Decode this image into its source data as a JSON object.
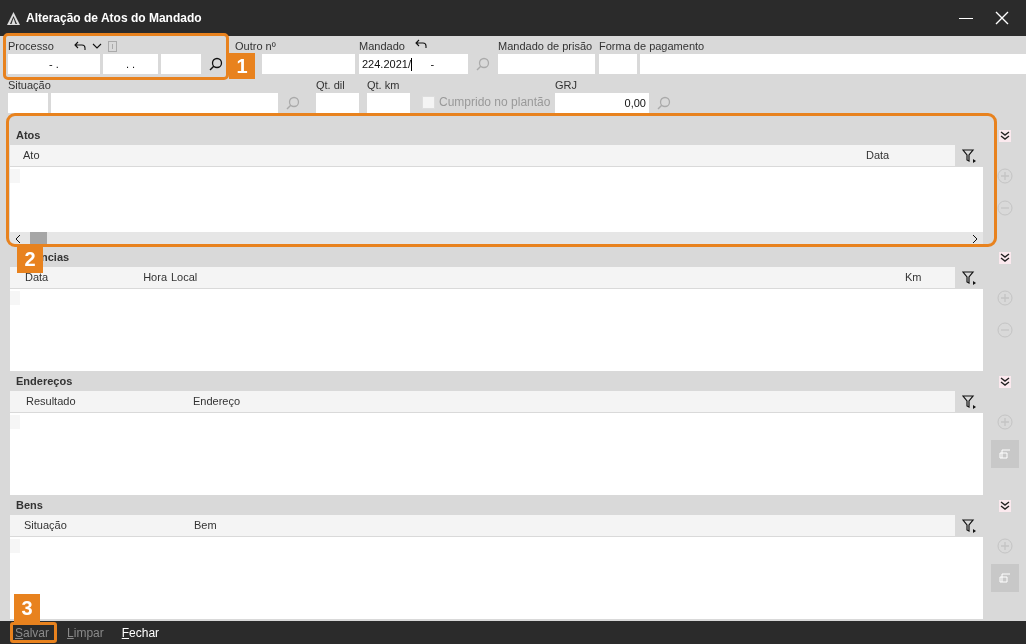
{
  "window": {
    "title": "Alteração de Atos do Mandado"
  },
  "fields_row_1": [
    {
      "label": "Processo",
      "history_icons": true,
      "inputs": [
        {
          "kind": "text",
          "value": "- ."
        },
        {
          "kind": "text",
          "value": ". ."
        },
        {
          "kind": "text"
        }
      ],
      "search": {
        "disabled": false
      }
    },
    {
      "label": "Outro nº",
      "inputs": [
        {
          "kind": "text"
        }
      ]
    },
    {
      "label": "Mandado",
      "undo_icon": true,
      "inputs": [
        {
          "kind": "text",
          "value": "224.2021/",
          "suffix": "-"
        }
      ],
      "search": {
        "disabled": true
      }
    },
    {
      "label": "Mandado de prisão",
      "inputs": [
        {
          "kind": "text"
        }
      ]
    },
    {
      "label": "Forma de pagamento",
      "inputs": [
        {
          "kind": "text"
        },
        {
          "kind": "text"
        }
      ]
    }
  ],
  "fields_row_2": [
    {
      "label": "Situação",
      "inputs": [
        {
          "kind": "text"
        },
        {
          "kind": "text"
        }
      ],
      "search": {
        "disabled": true
      }
    },
    {
      "label": "Qt. dil",
      "inputs": [
        {
          "kind": "text"
        }
      ]
    },
    {
      "label": "Qt. km",
      "inputs": [
        {
          "kind": "text"
        }
      ]
    },
    {
      "kind": "checkbox",
      "label": "Cumprido no plantão",
      "checked": false,
      "disabled": true
    },
    {
      "label": "GRJ",
      "inputs": [
        {
          "kind": "text",
          "value": "0,00"
        }
      ],
      "search": {
        "disabled": true
      }
    }
  ],
  "sections": [
    {
      "title": "Atos",
      "columns": [
        "Ato",
        "Data"
      ],
      "horizontal_scrollbar": true,
      "actions": [
        {
          "kind": "add",
          "disabled": true
        },
        {
          "kind": "remove",
          "disabled": true
        }
      ]
    },
    {
      "title": "ncias",
      "columns": [
        "Data",
        "Hora",
        "Local",
        "Km"
      ],
      "actions": [
        {
          "kind": "add",
          "disabled": true
        },
        {
          "kind": "remove",
          "disabled": true
        }
      ]
    },
    {
      "title": "Endereços",
      "columns": [
        "Resultado",
        "Endereço"
      ],
      "actions": [
        {
          "kind": "add",
          "disabled": true
        },
        {
          "kind": "detach",
          "disabled": true
        }
      ]
    },
    {
      "title": "Bens",
      "columns": [
        "Situação",
        "Bem"
      ],
      "actions": [
        {
          "kind": "add",
          "disabled": true
        },
        {
          "kind": "detach",
          "disabled": true
        }
      ]
    }
  ],
  "footer_buttons": [
    {
      "label": "Salvar",
      "disabled": true
    },
    {
      "label": "Limpar",
      "disabled": true
    },
    {
      "label": "Fechar",
      "disabled": false
    }
  ],
  "callouts": [
    {
      "number": "1"
    },
    {
      "number": "2"
    },
    {
      "number": "3"
    }
  ]
}
